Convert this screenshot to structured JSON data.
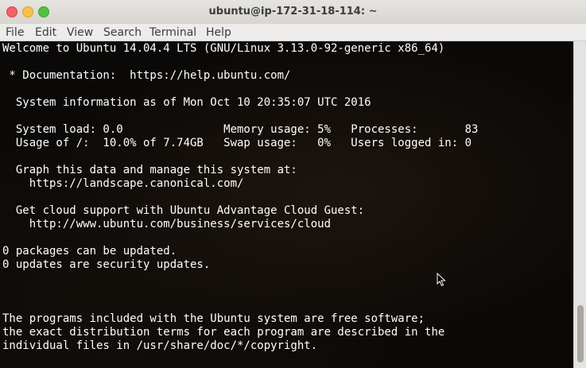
{
  "window": {
    "title": "ubuntu@ip-172-31-18-114: ~"
  },
  "menu": {
    "items": [
      "File",
      "Edit",
      "View",
      "Search",
      "Terminal",
      "Help"
    ]
  },
  "terminal": {
    "lines": [
      "Welcome to Ubuntu 14.04.4 LTS (GNU/Linux 3.13.0-92-generic x86_64)",
      "",
      " * Documentation:  https://help.ubuntu.com/",
      "",
      "  System information as of Mon Oct 10 20:35:07 UTC 2016",
      "",
      "  System load: 0.0               Memory usage: 5%   Processes:       83",
      "  Usage of /:  10.0% of 7.74GB   Swap usage:   0%   Users logged in: 0",
      "",
      "  Graph this data and manage this system at:",
      "    https://landscape.canonical.com/",
      "",
      "  Get cloud support with Ubuntu Advantage Cloud Guest:",
      "    http://www.ubuntu.com/business/services/cloud",
      "",
      "0 packages can be updated.",
      "0 updates are security updates.",
      "",
      "",
      "",
      "The programs included with the Ubuntu system are free software;",
      "the exact distribution terms for each program are described in the",
      "individual files in /usr/share/doc/*/copyright."
    ]
  },
  "colors": {
    "text": "#ffffff",
    "background": "#0b0907",
    "close": "#f46067",
    "minimize": "#f9be4c",
    "maximize": "#50c340"
  }
}
